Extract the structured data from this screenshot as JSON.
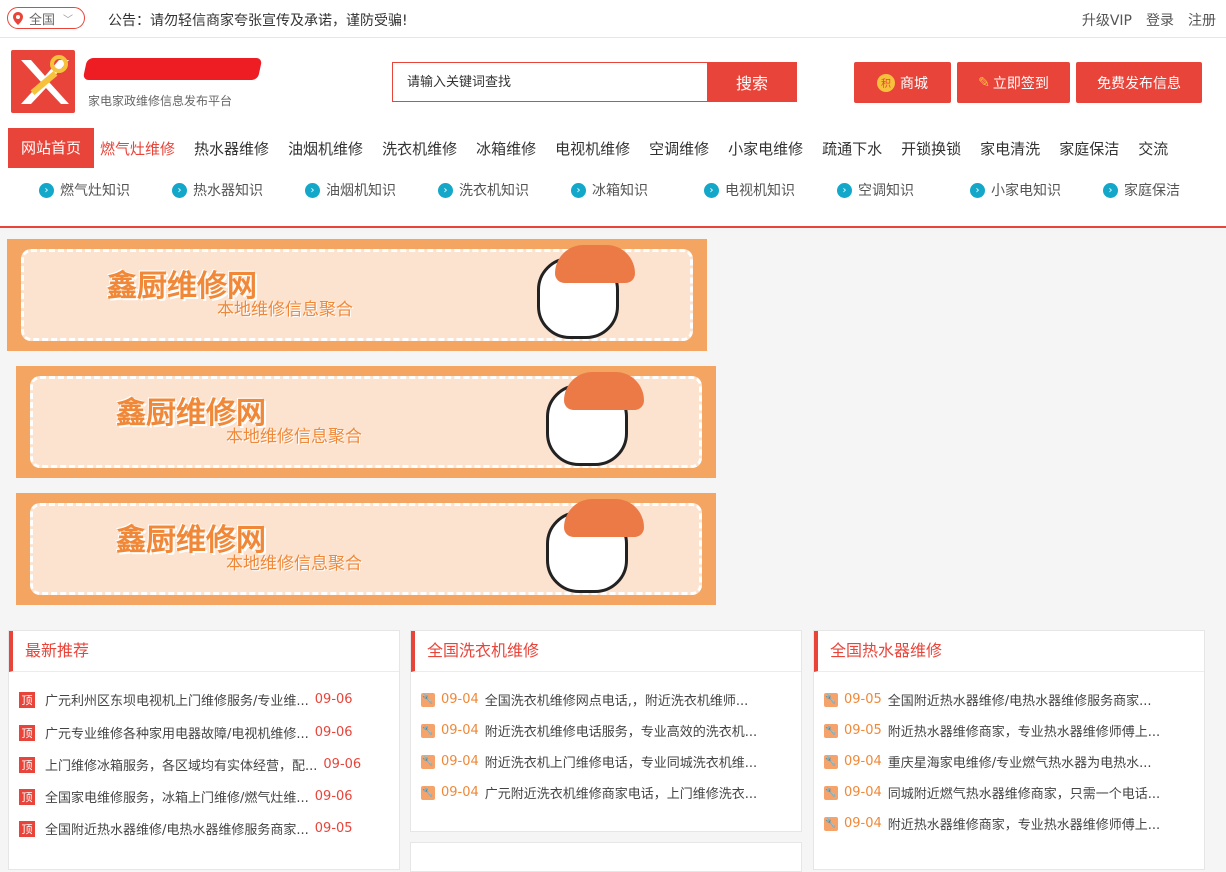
{
  "topbar": {
    "city": "全国",
    "notice": "公告：请勿轻信商家夸张宣传及承诺，谨防受骗!",
    "links": [
      "升级VIP",
      "登录",
      "注册"
    ]
  },
  "header": {
    "slogan": "家电家政维修信息发布平台",
    "search_placeholder": "请输入关键词查找",
    "search_button": "搜索",
    "btn_mall": "商城",
    "btn_signin": "立即签到",
    "btn_publish": "免费发布信息"
  },
  "nav": {
    "home": "网站首页",
    "items": [
      "燃气灶维修",
      "热水器维修",
      "油烟机维修",
      "洗衣机维修",
      "冰箱维修",
      "电视机维修",
      "空调维修",
      "小家电维修",
      "疏通下水",
      "开锁换锁",
      "家电清洗",
      "家庭保洁",
      "交流"
    ],
    "knowledge": [
      "燃气灶知识",
      "热水器知识",
      "油烟机知识",
      "洗衣机知识",
      "冰箱知识",
      "电视机知识",
      "空调知识",
      "小家电知识",
      "家庭保洁"
    ]
  },
  "banner": {
    "title": "鑫厨维修网",
    "subtitle": "本地维修信息聚合"
  },
  "panels": [
    {
      "title": "最新推荐",
      "items": [
        {
          "text": "广元利州区东坝电视机上门维修服务/专业维...",
          "date": "09-06"
        },
        {
          "text": "广元专业维修各种家用电器故障/电视机维修...",
          "date": "09-06"
        },
        {
          "text": "上门维修冰箱服务，各区域均有实体经营，配...",
          "date": "09-06"
        },
        {
          "text": "全国家电维修服务，冰箱上门维修/燃气灶维...",
          "date": "09-06"
        },
        {
          "text": "全国附近热水器维修/电热水器维修服务商家...",
          "date": "09-05"
        }
      ]
    },
    {
      "title": "全国洗衣机维修",
      "items": [
        {
          "date": "09-04",
          "text": "全国洗衣机维修网点电话,，附近洗衣机维师..."
        },
        {
          "date": "09-04",
          "text": "附近洗衣机维修电话服务，专业高效的洗衣机..."
        },
        {
          "date": "09-04",
          "text": "附近洗衣机上门维修电话，专业同城洗衣机维..."
        },
        {
          "date": "09-04",
          "text": "广元附近洗衣机维修商家电话，上门维修洗衣..."
        }
      ]
    },
    {
      "title": "全国热水器维修",
      "items": [
        {
          "date": "09-05",
          "text": "全国附近热水器维修/电热水器维修服务商家..."
        },
        {
          "date": "09-05",
          "text": "附近热水器维修商家，专业热水器维修师傅上..."
        },
        {
          "date": "09-04",
          "text": "重庆星海家电维修/专业燃气热水器为电热水..."
        },
        {
          "date": "09-04",
          "text": "同城附近燃气热水器维修商家，只需一个电话..."
        },
        {
          "date": "09-04",
          "text": "附近热水器维修商家，专业热水器维修师傅上..."
        }
      ]
    }
  ]
}
